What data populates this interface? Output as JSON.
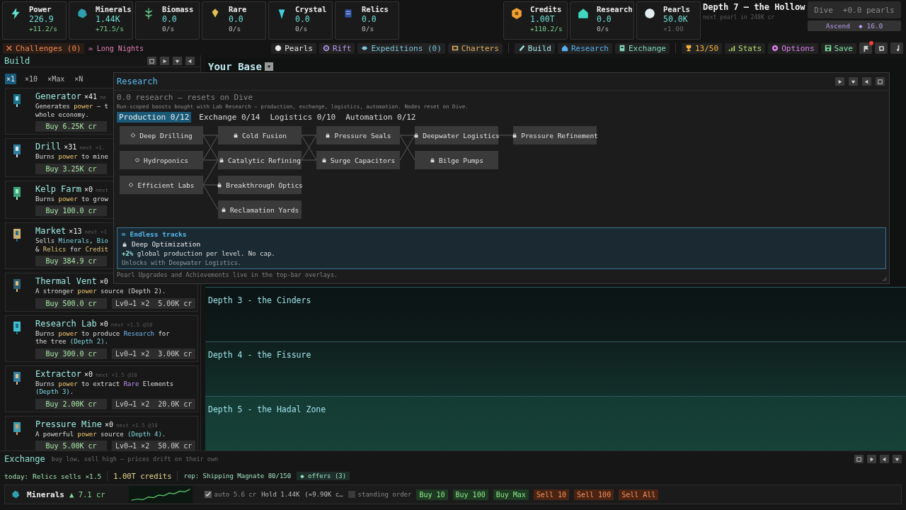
{
  "resources_left": [
    {
      "name": "Power",
      "value": "226.9",
      "rate": "+11.2/s",
      "kind": "up"
    },
    {
      "name": "Minerals",
      "value": "1.44K",
      "rate": "+71.5/s",
      "kind": "up"
    },
    {
      "name": "Biomass",
      "value": "0.0",
      "rate": "0/s",
      "kind": "flat"
    },
    {
      "name": "Rare",
      "value": "0.0",
      "rate": "0/s",
      "kind": "flat"
    },
    {
      "name": "Crystal",
      "value": "0.0",
      "rate": "0/s",
      "kind": "flat"
    },
    {
      "name": "Relics",
      "value": "0.0",
      "rate": "0/s",
      "kind": "flat"
    }
  ],
  "resources_right": [
    {
      "name": "Credits",
      "value": "1.00T",
      "rate": "+110.2/s",
      "kind": "up"
    },
    {
      "name": "Research",
      "value": "0.0",
      "rate": "0/s",
      "kind": "flat"
    },
    {
      "name": "Pearls",
      "value": "50.0K",
      "rate": "×1.00",
      "kind": "dim"
    }
  ],
  "depth": {
    "title": "Depth 7 — the Hollow",
    "subtitle": "next pearl in 248K cr"
  },
  "dive_button": {
    "label": "Dive",
    "reward": "+0.0 pearls",
    "disabled": true
  },
  "ascend_button": {
    "label": "Ascend",
    "cost": "◆ 16.0"
  },
  "challenges": "Challenges (0)",
  "modifier": "≈ Long Nights",
  "nav_left": [
    {
      "label": "Pearls",
      "color": "#e8e8e8"
    },
    {
      "label": "Rift",
      "color": "#b89cf0"
    },
    {
      "label": "Expeditions (0)",
      "color": "#7fc4dc"
    },
    {
      "label": "Charters",
      "color": "#e8b060"
    }
  ],
  "nav_mid": [
    {
      "label": "Build",
      "color": "#a8e8e8"
    },
    {
      "label": "Research",
      "color": "#58b0f0"
    },
    {
      "label": "Exchange",
      "color": "#7fd8b8"
    }
  ],
  "nav_right": [
    {
      "label": "13/50",
      "color": "#f0b040"
    },
    {
      "label": "Stats",
      "color": "#b8e070"
    },
    {
      "label": "Options",
      "color": "#e080f0"
    },
    {
      "label": "Save",
      "color": "#80e0a0"
    }
  ],
  "icon_buttons": [
    {
      "badge": true
    },
    {
      "badge": false
    },
    {
      "badge": false
    }
  ],
  "build": {
    "title": "Build",
    "multipliers": [
      {
        "label": "×1",
        "selected": true
      },
      {
        "label": "×10",
        "selected": false
      },
      {
        "label": "×Max",
        "selected": false
      },
      {
        "label": "×N",
        "selected": false
      }
    ],
    "items": [
      {
        "name": "Generator",
        "count": "×41",
        "next": "ne",
        "lines": [
          [
            "Generates ",
            {
              "t": "power",
              "kind": "power"
            },
            " — t"
          ],
          [
            "whole economy."
          ]
        ],
        "buy": "Buy 6.25K cr"
      },
      {
        "name": "Drill",
        "count": "×31",
        "next": "next ×1.",
        "lines": [
          [
            "Burns ",
            {
              "t": "power",
              "kind": "power"
            },
            " to mine"
          ]
        ],
        "buy": "Buy 3.25K cr"
      },
      {
        "name": "Kelp Farm",
        "count": "×0",
        "next": "next",
        "lines": [
          [
            "Burns ",
            {
              "t": "power",
              "kind": "power"
            },
            " to grow"
          ]
        ],
        "buy": "Buy 100.0 cr"
      },
      {
        "name": "Market",
        "count": "×13",
        "next": "next ×1",
        "lines": [
          [
            "Sells ",
            {
              "t": "Minerals",
              "kind": "teal"
            },
            ", ",
            {
              "t": "Bio",
              "kind": "teal"
            }
          ],
          [
            "& ",
            {
              "t": "Relics",
              "kind": "gold"
            },
            " for ",
            {
              "t": "Credit",
              "kind": "gold"
            }
          ]
        ],
        "buy": "Buy 384.9 cr"
      },
      {
        "name": "Thermal Vent",
        "count": "×0",
        "lines": [
          [
            "A stronger ",
            {
              "t": "power",
              "kind": "power"
            },
            " source (Depth 2)."
          ]
        ],
        "buy": "Buy 500.0 cr",
        "upgrade": "Lv0→1 ×2  5.00K cr"
      },
      {
        "name": "Research Lab",
        "count": "×0",
        "next": "next ×1.5 @10",
        "lines": [
          [
            "Burns ",
            {
              "t": "power",
              "kind": "power"
            },
            " to produce ",
            {
              "t": "Research",
              "kind": "blue"
            },
            " for"
          ],
          [
            "the tree ",
            {
              "t": "(Depth 2)",
              "kind": "teal"
            },
            "."
          ]
        ],
        "buy": "Buy 300.0 cr",
        "upgrade": "Lv0→1 ×2  3.00K cr"
      },
      {
        "name": "Extractor",
        "count": "×0",
        "next": "next ×1.5 @10",
        "lines": [
          [
            "Burns ",
            {
              "t": "power",
              "kind": "power"
            },
            " to extract ",
            {
              "t": "Rare",
              "kind": "purple"
            },
            " Elements"
          ],
          [
            {
              "t": "(Depth 3)",
              "kind": "teal"
            },
            "."
          ]
        ],
        "buy": "Buy 2.00K cr",
        "upgrade": "Lv0→1 ×2  20.0K cr"
      },
      {
        "name": "Pressure Mine",
        "count": "×0",
        "next": "next ×1.5 @10",
        "lines": [
          [
            "A powerful ",
            {
              "t": "power",
              "kind": "power"
            },
            " source ",
            {
              "t": "(Depth 4)",
              "kind": "teal"
            },
            "."
          ]
        ],
        "buy": "Buy 5.00K cr",
        "upgrade": "Lv0→1 ×2  50.0K cr"
      }
    ]
  },
  "base": {
    "title": "Your Base",
    "depths": [
      "Depth 3 - the Cinders",
      "Depth 4 - the Fissure",
      "Depth 5 - the Hadal Zone"
    ]
  },
  "research": {
    "title": "Research",
    "summary": "0.0 research — resets on Dive",
    "description": "Run-scoped boosts bought with Lab Research — production, exchange, logistics, automation. Nodes reset on Dive.",
    "tabs": [
      {
        "label": "Production 0/12",
        "selected": true
      },
      {
        "label": "Exchange 0/14",
        "selected": false
      },
      {
        "label": "Logistics 0/10",
        "selected": false
      },
      {
        "label": "Automation 0/12",
        "selected": false
      }
    ],
    "tree": [
      [
        {
          "label": "Deep Drilling",
          "kind": "open"
        },
        {
          "label": "Hydroponics",
          "kind": "open"
        },
        {
          "label": "Efficient Labs",
          "kind": "open"
        }
      ],
      [
        {
          "label": "Cold Fusion",
          "kind": "locked"
        },
        {
          "label": "Catalytic Refining",
          "kind": "locked"
        },
        {
          "label": "Breakthrough Optics",
          "kind": "locked"
        },
        {
          "label": "Reclamation Yards",
          "kind": "locked"
        }
      ],
      [
        {
          "label": "Pressure Seals",
          "kind": "locked"
        },
        {
          "label": "Surge Capacitors",
          "kind": "locked"
        }
      ],
      [
        {
          "label": "Deepwater Logistics",
          "kind": "locked"
        },
        {
          "label": "Bilge Pumps",
          "kind": "locked"
        }
      ],
      [
        {
          "label": "Pressure Refinement",
          "kind": "locked"
        }
      ]
    ],
    "endless": {
      "title": "≈ Endless tracks",
      "name": "Deep Optimization",
      "effect": "**+2%** global production per level. No cap.",
      "requirement": "Unlocks with Deepwater Logistics."
    },
    "footer": "Pearl Upgrades and Achievements live in the top-bar overlays."
  },
  "exchange": {
    "title": "Exchange",
    "tagline": "buy low, sell high — prices drift on their own",
    "today": "today: Relics sells ×1.5",
    "credits": "1.00T credits",
    "reputation": "rep: Shipping Magnate 80/150",
    "offers": "◆ offers (3)",
    "market": {
      "name": "Minerals",
      "price": "▲ 7.1 cr",
      "auto": {
        "checked": true,
        "label": "auto 5.6 cr"
      },
      "hold": "Hold 1.44K",
      "value": "(≈9.90K c…",
      "standing": {
        "checked": false,
        "label": "standing order"
      },
      "actions": [
        {
          "label": "Buy 10",
          "kind": "buy"
        },
        {
          "label": "Buy 100",
          "kind": "buy"
        },
        {
          "label": "Buy Max",
          "kind": "buy"
        },
        {
          "label": "Sell 10",
          "kind": "sell"
        },
        {
          "label": "Sell 100",
          "kind": "sell"
        },
        {
          "label": "Sell All",
          "kind": "sell"
        }
      ]
    }
  }
}
